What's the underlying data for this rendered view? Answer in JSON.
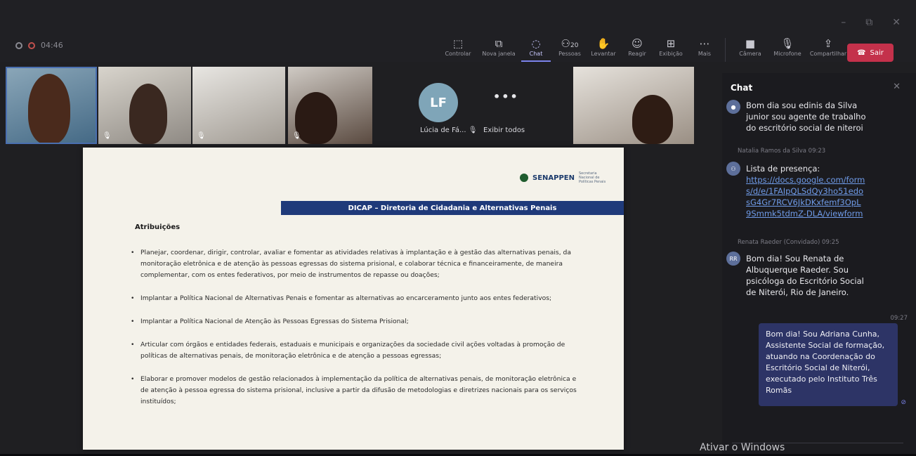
{
  "meeting": {
    "elapsed": "04:46"
  },
  "toolbar": {
    "items": [
      {
        "label": "Controlar",
        "icon": "control-icon"
      },
      {
        "label": "Nova janela",
        "icon": "new-window-icon"
      },
      {
        "label": "Chat",
        "icon": "chat-icon"
      },
      {
        "label": "Pessoas",
        "icon": "people-icon",
        "count": "20"
      },
      {
        "label": "Levantar",
        "icon": "raise-hand-icon"
      },
      {
        "label": "Reagir",
        "icon": "react-icon"
      },
      {
        "label": "Exibição",
        "icon": "view-icon"
      },
      {
        "label": "Mais",
        "icon": "more-icon"
      }
    ],
    "devices": [
      {
        "label": "Câmera",
        "icon": "camera-icon"
      },
      {
        "label": "Microfone",
        "icon": "microphone-icon"
      },
      {
        "label": "Compartilhar",
        "icon": "share-icon"
      }
    ],
    "leave_label": "Sair"
  },
  "gallery": {
    "lf_initials": "LF",
    "lf_name": "Lúcia de Fá...",
    "show_all": "Exibir todos"
  },
  "slide": {
    "brand": "SENAPPEN",
    "brand_sub": "Secretaria Nacional de Políticas Penais",
    "title": "DICAP – Diretoria de Cidadania e Alternativas Penais",
    "section": "Atribuições",
    "bullets": [
      "Planejar, coordenar, dirigir, controlar, avaliar e fomentar as atividades relativas à implantação e à gestão das alternativas penais, da monitoração eletrônica e de atenção às pessoas egressas do sistema prisional, e colaborar técnica e financeiramente, de maneira complementar, com os entes federativos, por meio de instrumentos de repasse ou doações;",
      "Implantar a Política Nacional de Alternativas Penais e fomentar as alternativas ao encarceramento junto aos entes federativos;",
      "Implantar a Política Nacional de Atenção às Pessoas Egressas do Sistema Prisional;",
      "Articular com órgãos e entidades federais, estaduais e municipais e organizações da sociedade civil ações voltadas à promoção de políticas de alternativas penais, de monitoração eletrônica e de atenção a pessoas egressas;",
      "Elaborar e promover modelos de gestão relacionados à implementação da política de alternativas penais, de monitoração eletrônica e de atenção à pessoa egressa do sistema prisional, inclusive a partir da difusão de metodologias e diretrizes nacionais para os serviços instituídos;"
    ]
  },
  "chat": {
    "title": "Chat",
    "messages": [
      {
        "author": "",
        "time": "",
        "text": "Bom dia sou edinis da Silva junior sou agente de trabalho do escritório social de niteroi"
      },
      {
        "author": "Natalia Ramos da Silva",
        "time": "09:23",
        "text": "Lista de presença:",
        "link": "https://docs.google.com/forms/d/e/1FAIpQLSdQy3ho51edosG4Gr7RCV6JkDKxfemf3OpL9Smmk5tdmZ-DLA/viewform"
      },
      {
        "author": "Renata Raeder (Convidado)",
        "time": "09:25",
        "initials": "RR",
        "text": "Bom dia! Sou Renata de Albuquerque Raeder. Sou psicóloga do Escritório Social de Niterói, Rio de Janeiro."
      }
    ],
    "my_message": {
      "time": "09:27",
      "text": "Bom dia! Sou Adriana Cunha, Assistente Social de formação, atuando na Coordenação do Escritório Social de Niterói, executado pelo Instituto Três Romãs"
    }
  },
  "watermark": "Ativar o Windows"
}
